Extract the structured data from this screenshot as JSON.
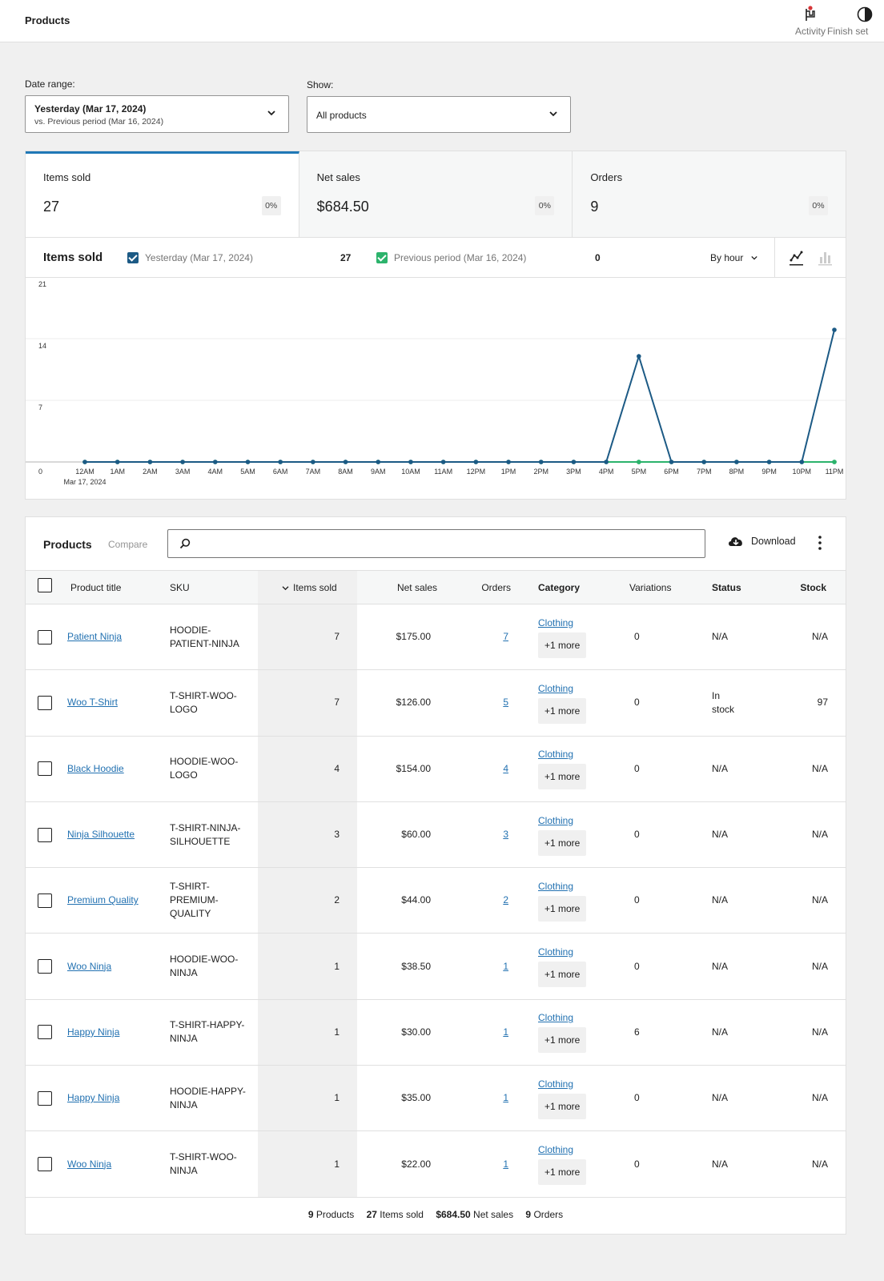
{
  "header": {
    "title": "Products",
    "activity_label": "Activity",
    "finish_label": "Finish setup",
    "finish_visible": "Finish set"
  },
  "filters": {
    "date_label": "Date range:",
    "date_primary": "Yesterday (Mar 17, 2024)",
    "date_secondary": "vs. Previous period (Mar 16, 2024)",
    "show_label": "Show:",
    "show_value": "All products"
  },
  "summary": [
    {
      "label": "Items sold",
      "value": "27",
      "delta": "0%",
      "active": true
    },
    {
      "label": "Net sales",
      "value": "$684.50",
      "delta": "0%",
      "active": false
    },
    {
      "label": "Orders",
      "value": "9",
      "delta": "0%",
      "active": false
    }
  ],
  "chart_header": {
    "title": "Items sold",
    "legend_current": "Yesterday (Mar 17, 2024)",
    "legend_current_total": "27",
    "legend_previous": "Previous period (Mar 16, 2024)",
    "legend_previous_total": "0",
    "interval": "By hour"
  },
  "colors": {
    "current": "#1c5a85",
    "previous": "#2cb36c",
    "accent": "#1f78b6",
    "link": "#2271b1"
  },
  "chart_data": {
    "type": "line",
    "title": "Items sold",
    "xlabel": "",
    "ylabel": "",
    "x": [
      "12AM",
      "1AM",
      "2AM",
      "3AM",
      "4AM",
      "5AM",
      "6AM",
      "7AM",
      "8AM",
      "9AM",
      "10AM",
      "11AM",
      "12PM",
      "1PM",
      "2PM",
      "3PM",
      "4PM",
      "5PM",
      "6PM",
      "7PM",
      "8PM",
      "9PM",
      "10PM",
      "11PM"
    ],
    "x_sublabel": "Mar 17, 2024",
    "yticks": [
      0,
      7,
      14,
      21
    ],
    "ylim": [
      0,
      21
    ],
    "grid": true,
    "series": [
      {
        "name": "Previous period (Mar 16, 2024)",
        "color": "#2cb36c",
        "values": [
          0,
          0,
          0,
          0,
          0,
          0,
          0,
          0,
          0,
          0,
          0,
          0,
          0,
          0,
          0,
          0,
          0,
          0,
          0,
          0,
          0,
          0,
          0,
          0
        ]
      },
      {
        "name": "Yesterday (Mar 17, 2024)",
        "color": "#1c5a85",
        "values": [
          0,
          0,
          0,
          0,
          0,
          0,
          0,
          0,
          0,
          0,
          0,
          0,
          0,
          0,
          0,
          0,
          0,
          12,
          0,
          0,
          0,
          0,
          0,
          15
        ]
      }
    ]
  },
  "table": {
    "title": "Products",
    "compare_label": "Compare",
    "search_placeholder": "",
    "download_label": "Download",
    "columns": [
      "Product title",
      "SKU",
      "Items sold",
      "Net sales",
      "Orders",
      "Category",
      "Variations",
      "Status",
      "Stock"
    ],
    "rows": [
      {
        "title": "Patient Ninja",
        "sku": "HOODIE-PATIENT-NINJA",
        "items": "7",
        "net": "$175.00",
        "orders": "7",
        "category": "Clothing",
        "more": "+1 more",
        "variations": "0",
        "status": "N/A",
        "stock": "N/A"
      },
      {
        "title": "Woo T-Shirt",
        "sku": "T-SHIRT-WOO-LOGO",
        "items": "7",
        "net": "$126.00",
        "orders": "5",
        "category": "Clothing",
        "more": "+1 more",
        "variations": "0",
        "status": "In stock",
        "stock": "97"
      },
      {
        "title": "Black Hoodie",
        "sku": "HOODIE-WOO-LOGO",
        "items": "4",
        "net": "$154.00",
        "orders": "4",
        "category": "Clothing",
        "more": "+1 more",
        "variations": "0",
        "status": "N/A",
        "stock": "N/A"
      },
      {
        "title": "Ninja Silhouette",
        "sku": "T-SHIRT-NINJA-SILHOUETTE",
        "items": "3",
        "net": "$60.00",
        "orders": "3",
        "category": "Clothing",
        "more": "+1 more",
        "variations": "0",
        "status": "N/A",
        "stock": "N/A"
      },
      {
        "title": "Premium Quality",
        "sku": "T-SHIRT-PREMIUM-QUALITY",
        "items": "2",
        "net": "$44.00",
        "orders": "2",
        "category": "Clothing",
        "more": "+1 more",
        "variations": "0",
        "status": "N/A",
        "stock": "N/A"
      },
      {
        "title": "Woo Ninja",
        "sku": "HOODIE-WOO-NINJA",
        "items": "1",
        "net": "$38.50",
        "orders": "1",
        "category": "Clothing",
        "more": "+1 more",
        "variations": "0",
        "status": "N/A",
        "stock": "N/A"
      },
      {
        "title": "Happy Ninja",
        "sku": "T-SHIRT-HAPPY-NINJA",
        "items": "1",
        "net": "$30.00",
        "orders": "1",
        "category": "Clothing",
        "more": "+1 more",
        "variations": "6",
        "status": "N/A",
        "stock": "N/A"
      },
      {
        "title": "Happy Ninja",
        "sku": "HOODIE-HAPPY-NINJA",
        "items": "1",
        "net": "$35.00",
        "orders": "1",
        "category": "Clothing",
        "more": "+1 more",
        "variations": "0",
        "status": "N/A",
        "stock": "N/A"
      },
      {
        "title": "Woo Ninja",
        "sku": "T-SHIRT-WOO-NINJA",
        "items": "1",
        "net": "$22.00",
        "orders": "1",
        "category": "Clothing",
        "more": "+1 more",
        "variations": "0",
        "status": "N/A",
        "stock": "N/A"
      }
    ],
    "footer": {
      "products_count": "9",
      "products_label": "Products",
      "items_count": "27",
      "items_label": "Items sold",
      "net_count": "$684.50",
      "net_label": "Net sales",
      "orders_count": "9",
      "orders_label": "Orders"
    }
  }
}
